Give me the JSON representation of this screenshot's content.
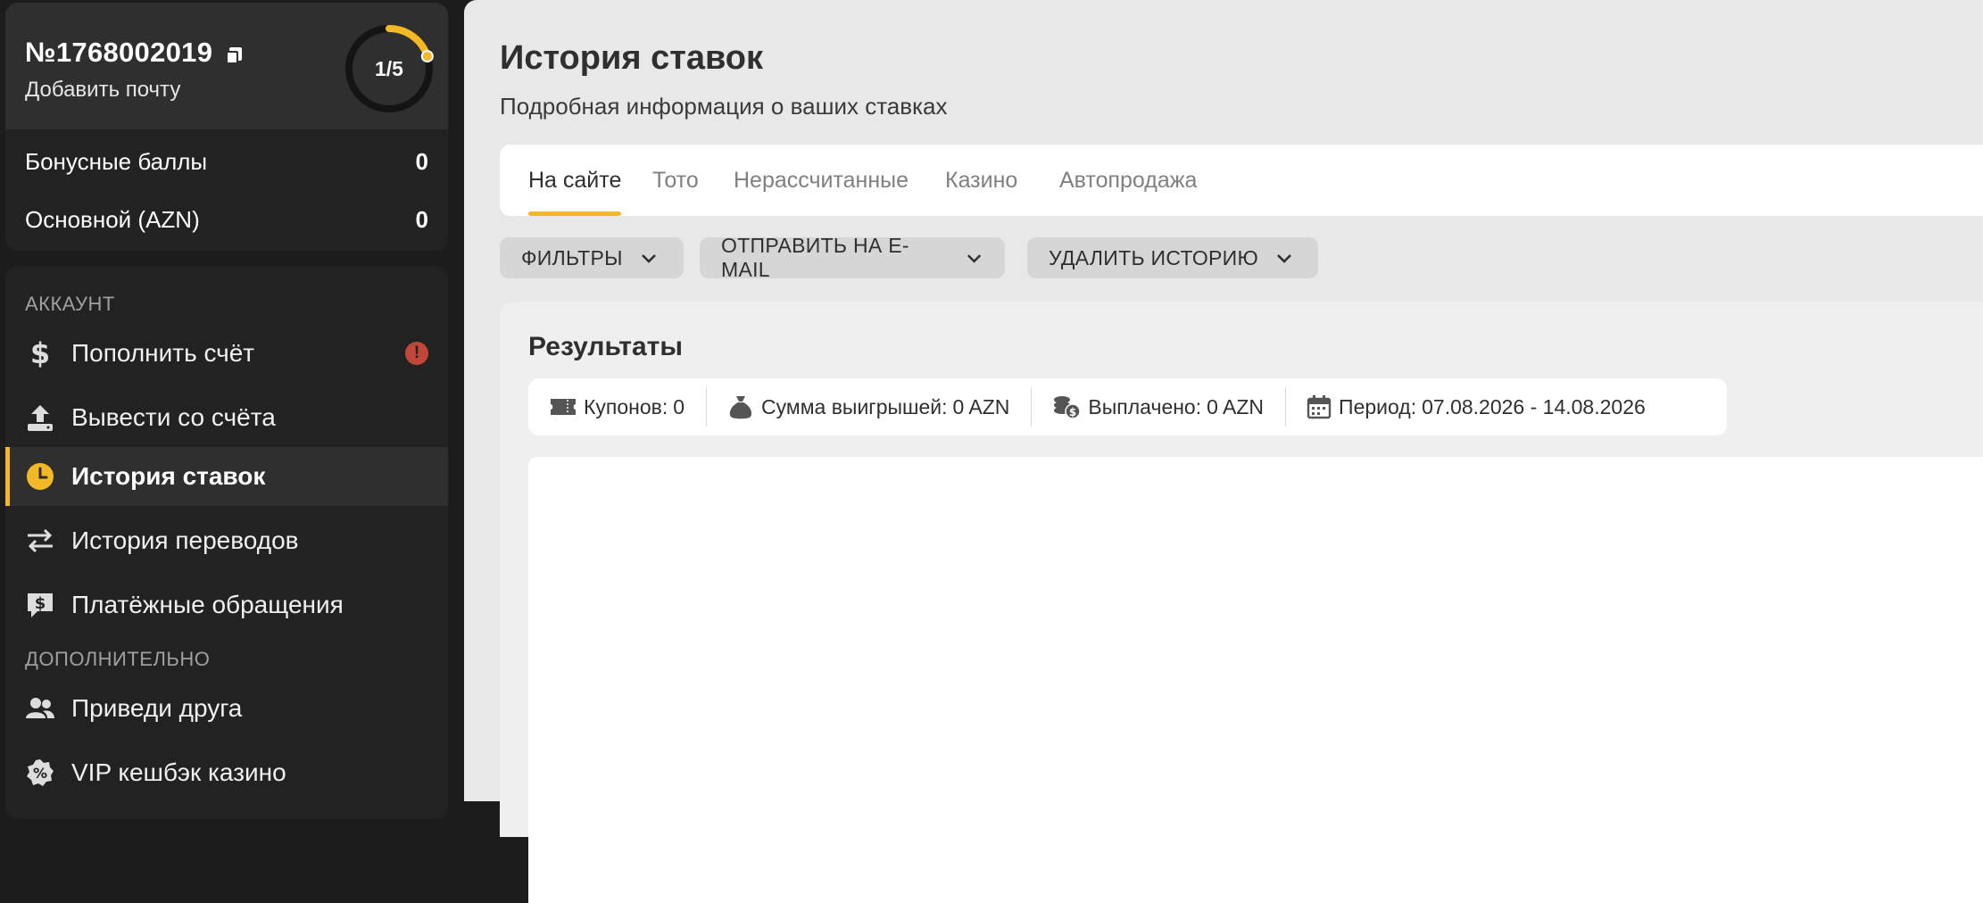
{
  "profile": {
    "account_number": "№1768002019",
    "add_email": "Добавить почту",
    "progress_text": "1/5",
    "progress_fraction": 0.2
  },
  "balances": [
    {
      "label": "Бонусные баллы",
      "value": "0"
    },
    {
      "label": "Основной (AZN)",
      "value": "0"
    }
  ],
  "menu": {
    "section_account": "АККАУНТ",
    "section_extra": "ДОПОЛНИТЕЛЬНО",
    "items": [
      {
        "label": "Пополнить счёт",
        "icon": "dollar-icon"
      },
      {
        "label": "Вывести со счёта",
        "icon": "upload-icon"
      },
      {
        "label": "История ставок",
        "icon": "clock-icon"
      },
      {
        "label": "История переводов",
        "icon": "transfer-icon"
      },
      {
        "label": "Платёжные обращения",
        "icon": "payment-chat-icon"
      },
      {
        "label": "Приведи друга",
        "icon": "users-icon"
      },
      {
        "label": "VIP кешбэк казино",
        "icon": "cashback-badge-icon"
      }
    ],
    "alert_badge": "!"
  },
  "page": {
    "title": "История ставок",
    "subtitle": "Подробная информация о ваших ставках"
  },
  "tabs": [
    {
      "label": "На сайте"
    },
    {
      "label": "Тото"
    },
    {
      "label": "Нерассчитанные"
    },
    {
      "label": "Казино"
    },
    {
      "label": "Автопродажа"
    }
  ],
  "actions": {
    "filters": "ФИЛЬТРЫ",
    "send_email": "ОТПРАВИТЬ НА E-MAIL",
    "delete_history": "УДАЛИТЬ ИСТОРИЮ"
  },
  "results": {
    "title": "Результаты",
    "coupons_label": "Купонов:",
    "coupons_value": "0",
    "winnings_label": "Сумма выигрышей:",
    "winnings_value": "0 AZN",
    "paid_label": "Выплачено:",
    "paid_value": "0 AZN",
    "period_label": "Период:",
    "period_value": "07.08.2026 - 14.08.2026"
  },
  "colors": {
    "accent": "#f3b825",
    "sidebar_bg": "#1c1c1c",
    "main_bg": "#e8e8e8",
    "alert": "#c0473a"
  }
}
